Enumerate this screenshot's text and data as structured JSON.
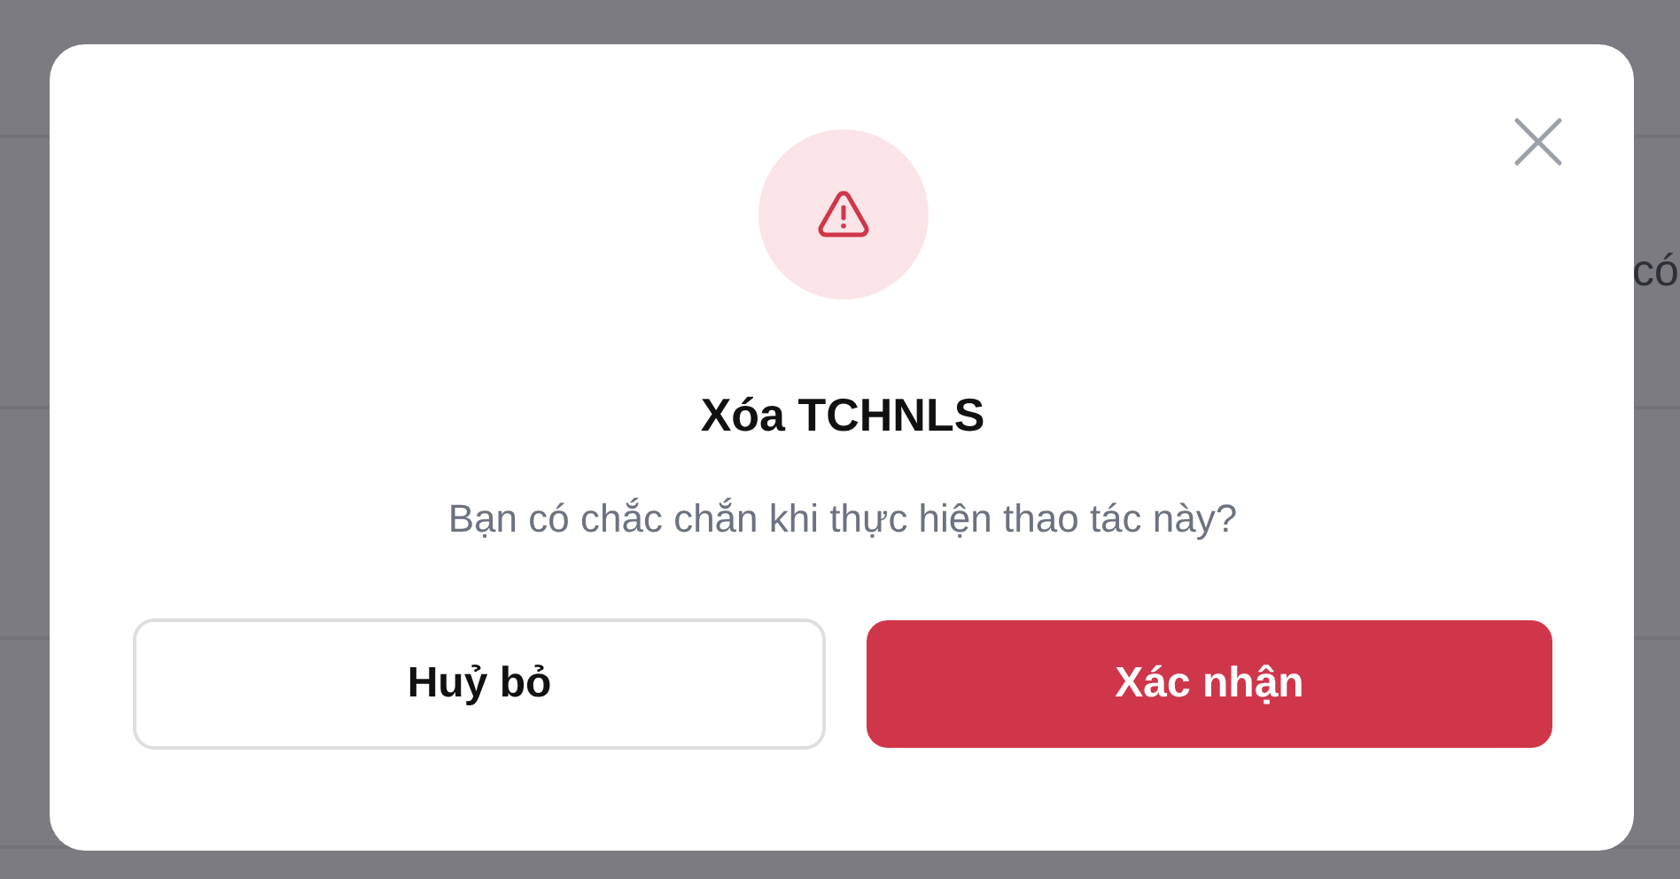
{
  "background": {
    "cell_text": "có"
  },
  "dialog": {
    "title": "Xóa TCHNLS",
    "message": "Bạn có chắc chắn khi thực hiện thao tác này?",
    "buttons": [
      {
        "label": "Huỷ bỏ",
        "kind": "secondary"
      },
      {
        "label": "Xác nhận",
        "kind": "danger"
      }
    ]
  }
}
